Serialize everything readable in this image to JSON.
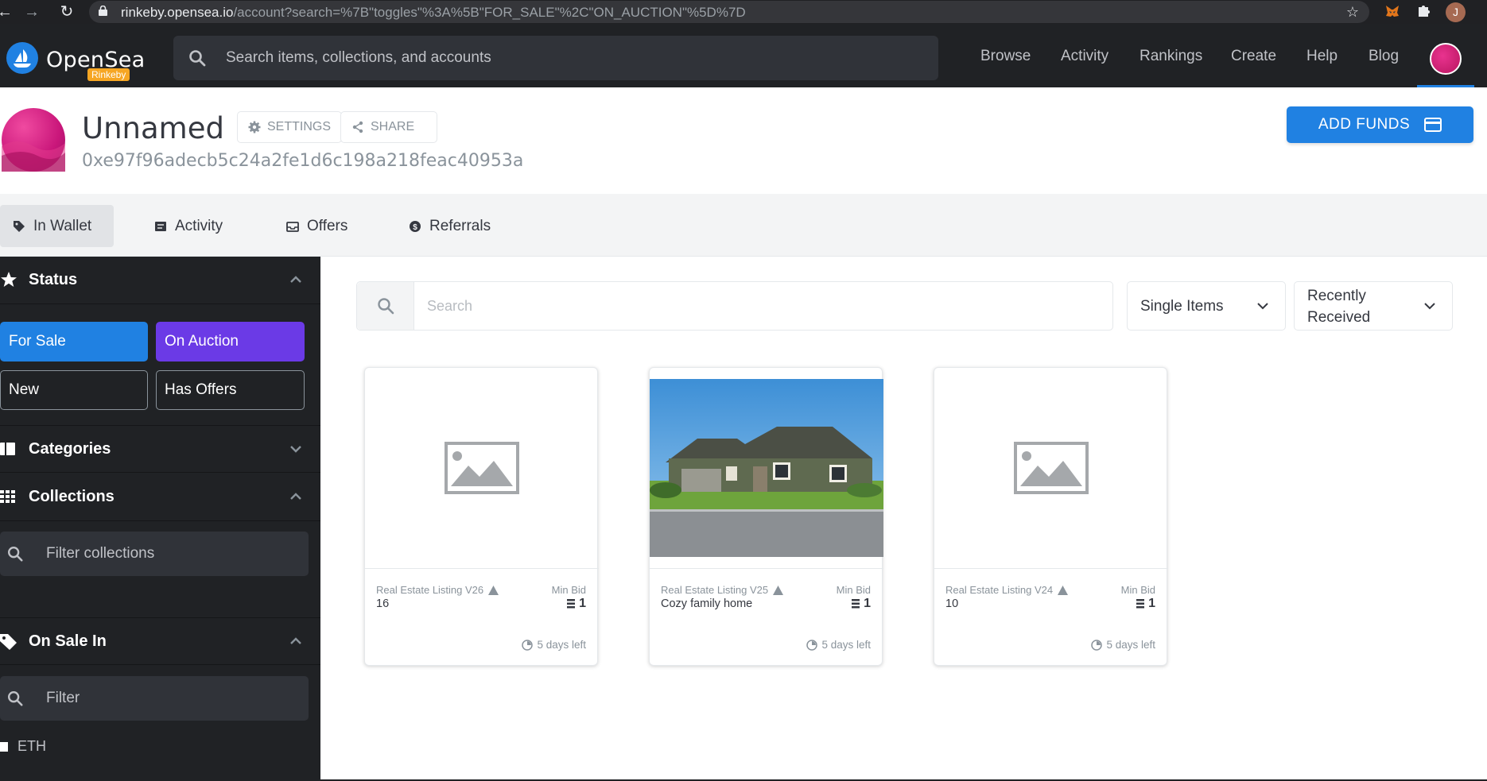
{
  "browser": {
    "url_host": "rinkeby.opensea.io",
    "url_path": "/account?search=%7B\"toggles\"%3A%5B\"FOR_SALE\"%2C\"ON_AUCTION\"%5D%7D",
    "profile_initial": "J"
  },
  "header": {
    "brand": "OpenSea",
    "network": "Rinkeby",
    "search_placeholder": "Search items, collections, and accounts",
    "nav": [
      "Browse",
      "Activity",
      "Rankings",
      "Create",
      "Help",
      "Blog"
    ]
  },
  "profile": {
    "name": "Unnamed",
    "address": "0xe97f96adecb5c24a2fe1d6c198a218feac40953a",
    "settings_label": "SETTINGS",
    "share_label": "SHARE",
    "add_funds_label": "ADD FUNDS"
  },
  "tabs": [
    {
      "label": "In Wallet",
      "active": true
    },
    {
      "label": "Activity",
      "active": false
    },
    {
      "label": "Offers",
      "active": false
    },
    {
      "label": "Referrals",
      "active": false
    }
  ],
  "sidebar": {
    "status_title": "Status",
    "status_buttons": [
      {
        "label": "For Sale",
        "selected": true,
        "color": "#2081e2"
      },
      {
        "label": "On Auction",
        "selected": true,
        "color": "#6b3ae6"
      },
      {
        "label": "New",
        "selected": false
      },
      {
        "label": "Has Offers",
        "selected": false
      }
    ],
    "categories_title": "Categories",
    "collections_title": "Collections",
    "collections_filter_placeholder": "Filter collections",
    "on_sale_title": "On Sale In",
    "on_sale_filter_placeholder": "Filter",
    "currencies": [
      "ETH"
    ]
  },
  "main": {
    "search_placeholder": "Search",
    "item_type": "Single Items",
    "sort_line1": "Recently",
    "sort_line2": "Received"
  },
  "cards": [
    {
      "collection": "Real Estate Listing V26",
      "name": "16",
      "bid_label": "Min Bid",
      "bid_value": "1",
      "time_left": "5 days left",
      "image": "placeholder"
    },
    {
      "collection": "Real Estate Listing V25",
      "name": "Cozy family home",
      "bid_label": "Min Bid",
      "bid_value": "1",
      "time_left": "5 days left",
      "image": "house-photo"
    },
    {
      "collection": "Real Estate Listing V24",
      "name": "10",
      "bid_label": "Min Bid",
      "bid_value": "1",
      "time_left": "5 days left",
      "image": "placeholder"
    }
  ],
  "colors": {
    "accent": "#2081e2",
    "auction": "#6b3ae6",
    "dark": "#202225",
    "network_badge": "#f6a623"
  }
}
